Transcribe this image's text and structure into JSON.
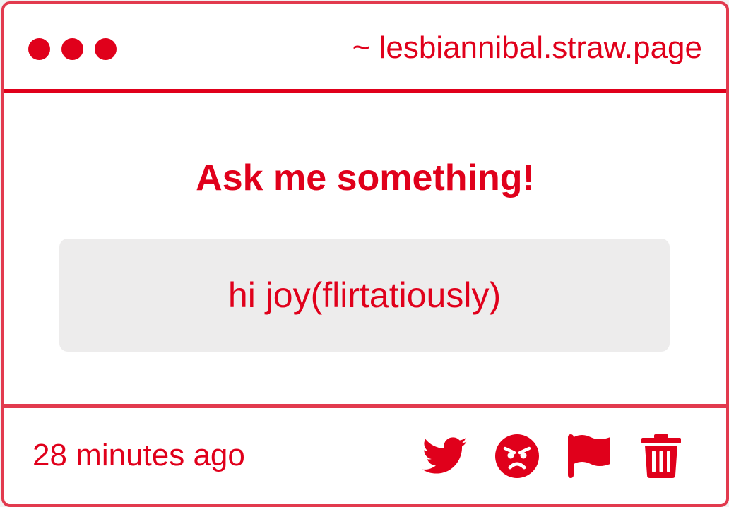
{
  "window": {
    "url": "~ lesbiannibal.straw.page",
    "dots": [
      "window-dot",
      "window-dot",
      "window-dot"
    ]
  },
  "main": {
    "heading": "Ask me something!",
    "message": "hi joy(flirtatiously)"
  },
  "footer": {
    "timestamp": "28 minutes ago",
    "actions": [
      {
        "icon": "twitter-bird-icon"
      },
      {
        "icon": "angry-face-icon"
      },
      {
        "icon": "flag-icon"
      },
      {
        "icon": "trash-icon"
      }
    ]
  },
  "colors": {
    "accent": "#e0001b",
    "border": "#e23a4e",
    "message_bg": "#edecec",
    "card_bg": "#ffffff"
  }
}
